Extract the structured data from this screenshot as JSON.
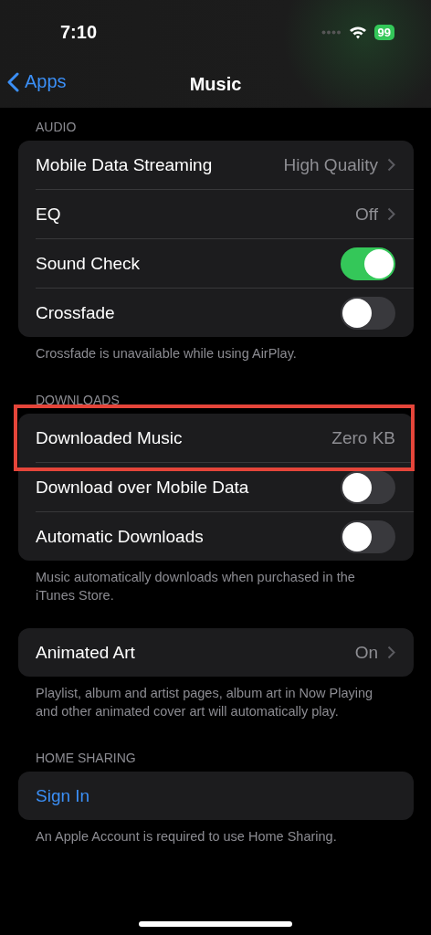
{
  "status_bar": {
    "time": "7:10",
    "battery": "99"
  },
  "nav": {
    "back": "Apps",
    "title": "Music"
  },
  "sections": [
    {
      "header": "AUDIO",
      "rows": [
        {
          "kind": "detail",
          "label": "Mobile Data Streaming",
          "value": "High Quality"
        },
        {
          "kind": "detail",
          "label": "EQ",
          "value": "Off"
        },
        {
          "kind": "toggle",
          "label": "Sound Check",
          "on": true
        },
        {
          "kind": "toggle",
          "label": "Crossfade",
          "on": false
        }
      ],
      "footer": "Crossfade is unavailable while using AirPlay."
    },
    {
      "header": "DOWNLOADS",
      "rows": [
        {
          "kind": "info",
          "label": "Downloaded Music",
          "value": "Zero KB",
          "highlighted": true
        },
        {
          "kind": "toggle",
          "label": "Download over Mobile Data",
          "on": false
        },
        {
          "kind": "toggle",
          "label": "Automatic Downloads",
          "on": false
        }
      ],
      "footer": "Music automatically downloads when purchased in the iTunes Store."
    },
    {
      "rows": [
        {
          "kind": "detail",
          "label": "Animated Art",
          "value": "On"
        }
      ],
      "footer": "Playlist, album and artist pages, album art in Now Playing and other animated cover art will automatically play."
    },
    {
      "header": "HOME SHARING",
      "rows": [
        {
          "kind": "link",
          "label": "Sign In"
        }
      ],
      "footer": "An Apple Account is required to use Home Sharing."
    }
  ]
}
